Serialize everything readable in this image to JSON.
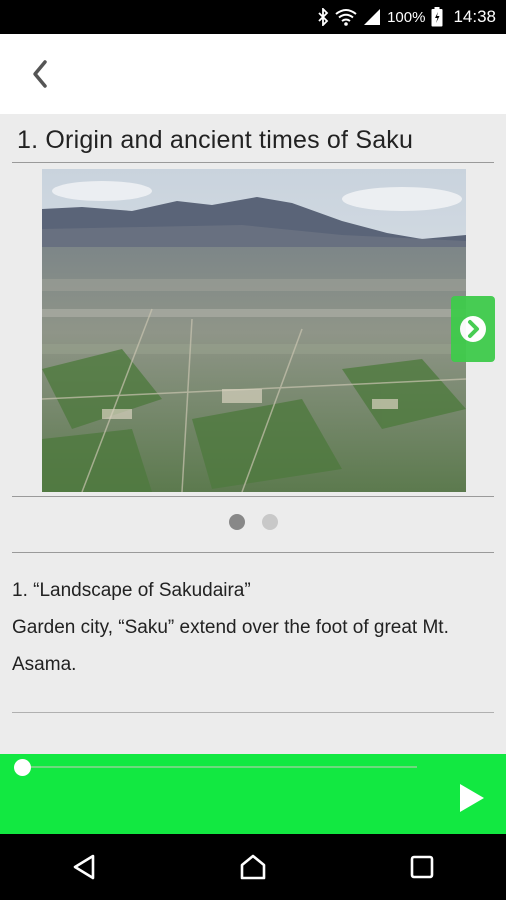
{
  "status_bar": {
    "icons": [
      "bluetooth-icon",
      "wifi-icon",
      "signal-icon",
      "battery-icon"
    ],
    "battery_text": "100%",
    "time": "14:38"
  },
  "header": {
    "back_icon": "chevron-left-icon"
  },
  "main": {
    "title": "1. Origin and ancient times of Saku",
    "image_alt": "Landscape of Sakudaira",
    "next_icon": "chevron-right-circle-icon",
    "pager": {
      "count": 2,
      "active": 1
    },
    "caption_title": "1. “Landscape of Sakudaira”",
    "caption_body": "Garden city, “Saku” extend over the foot of great Mt. Asama."
  },
  "player": {
    "progress": 0.0,
    "play_icon": "play-icon",
    "colors": {
      "bar": "#12e841",
      "next_button": "#3fcb4b"
    }
  },
  "nav_bar": {
    "icons": [
      "back-triangle-icon",
      "home-icon",
      "recents-icon"
    ]
  }
}
